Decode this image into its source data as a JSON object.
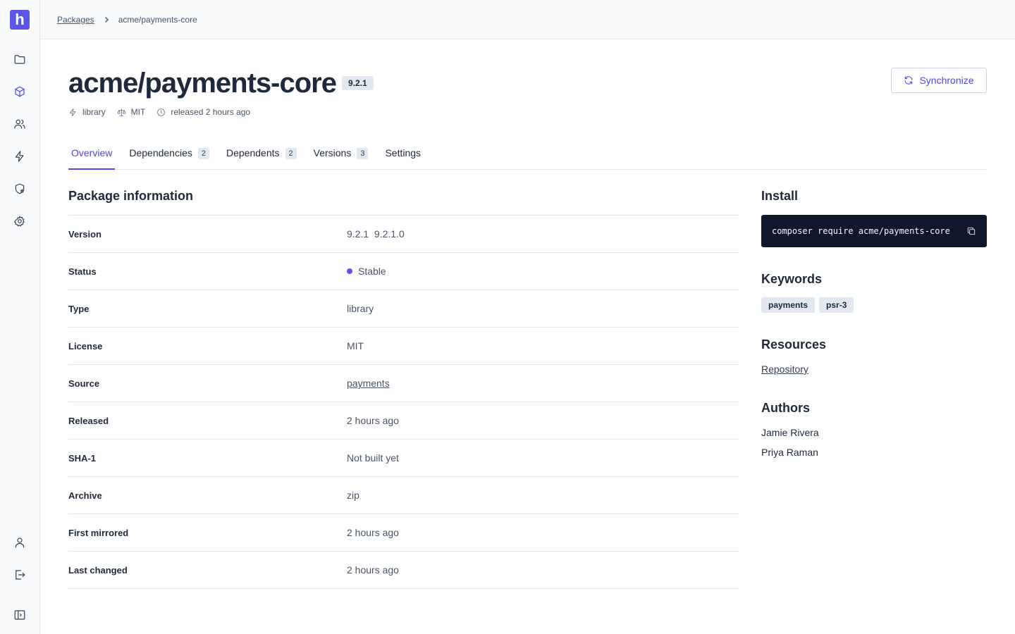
{
  "app": {
    "logo_letter": "h"
  },
  "breadcrumb": {
    "root": "Packages",
    "current": "acme/payments-core"
  },
  "package": {
    "name": "acme/payments-core",
    "version_badge": "9.2.1",
    "meta": {
      "type": "library",
      "license": "MIT",
      "released": "released 2 hours ago"
    }
  },
  "actions": {
    "synchronize": "Synchronize"
  },
  "tabs": [
    {
      "label": "Overview",
      "count": ""
    },
    {
      "label": "Dependencies",
      "count": "2"
    },
    {
      "label": "Dependents",
      "count": "2"
    },
    {
      "label": "Versions",
      "count": "3"
    },
    {
      "label": "Settings",
      "count": ""
    }
  ],
  "info": {
    "title": "Package information",
    "rows": [
      {
        "key": "Version",
        "value": "9.2.1  9.2.1.0"
      },
      {
        "key": "Status",
        "value": "Stable"
      },
      {
        "key": "Type",
        "value": "library"
      },
      {
        "key": "License",
        "value": "MIT"
      },
      {
        "key": "Source",
        "value": "payments"
      },
      {
        "key": "Released",
        "value": "2 hours ago"
      },
      {
        "key": "SHA-1",
        "value": "Not built yet"
      },
      {
        "key": "Archive",
        "value": "zip"
      },
      {
        "key": "First mirrored",
        "value": "2 hours ago"
      },
      {
        "key": "Last changed",
        "value": "2 hours ago"
      }
    ]
  },
  "install": {
    "title": "Install",
    "command": "composer require acme/payments-core"
  },
  "keywords": {
    "title": "Keywords",
    "items": [
      "payments",
      "psr-3"
    ]
  },
  "resources": {
    "title": "Resources",
    "link": "Repository"
  },
  "authors": {
    "title": "Authors",
    "items": [
      "Jamie Rivera",
      "Priya Raman"
    ]
  },
  "colors": {
    "accent": "#4f46e5",
    "logo": "#5b56e8",
    "install_bg": "#0f172a"
  }
}
